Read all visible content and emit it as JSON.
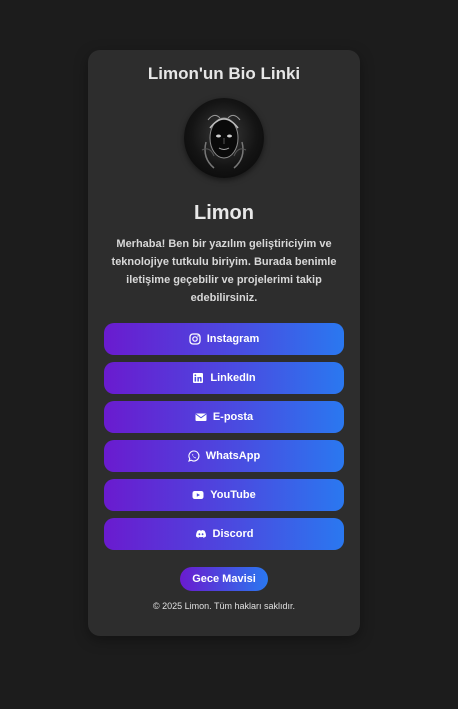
{
  "header": {
    "title": "Limon'un Bio Linki"
  },
  "profile": {
    "name": "Limon",
    "bio": "Merhaba! Ben bir yazılım geliştiriciyim ve teknolojiye tutkulu biriyim. Burada benimle iletişime geçebilir ve projelerimi takip edebilirsiniz."
  },
  "links": [
    {
      "label": "Instagram",
      "icon": "instagram-icon"
    },
    {
      "label": "LinkedIn",
      "icon": "linkedin-icon"
    },
    {
      "label": "E-posta",
      "icon": "envelope-icon"
    },
    {
      "label": "WhatsApp",
      "icon": "whatsapp-icon"
    },
    {
      "label": "YouTube",
      "icon": "youtube-icon"
    },
    {
      "label": "Discord",
      "icon": "discord-icon"
    }
  ],
  "theme_toggle": {
    "label": "Gece Mavisi"
  },
  "footer": {
    "copyright": "© 2025 Limon. Tüm hakları saklıdır."
  },
  "colors": {
    "background": "#1c1c1c",
    "card": "#2d2d2d",
    "gradient_start": "#6a1bcf",
    "gradient_end": "#2a78f0"
  }
}
